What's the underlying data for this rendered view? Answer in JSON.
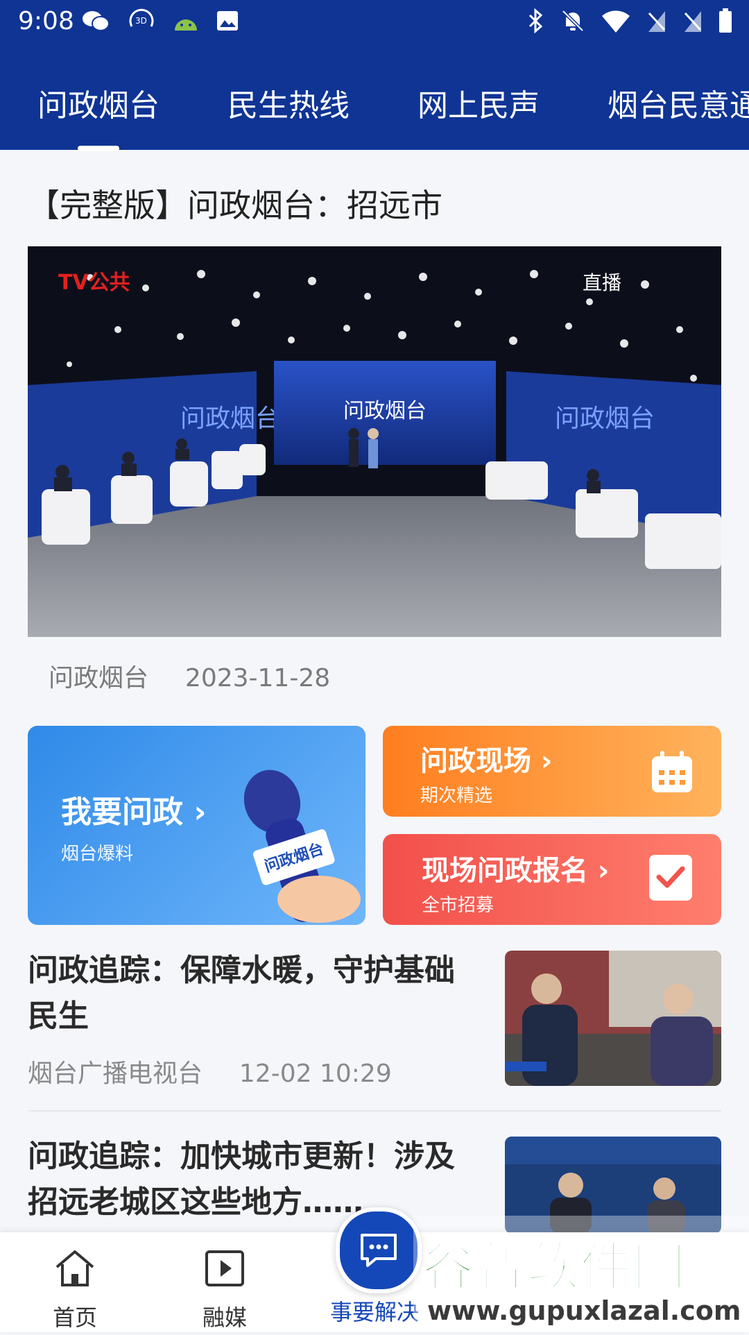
{
  "status_bar": {
    "time": "9:08",
    "left_icons": [
      "wechat-icon",
      "3d-icon",
      "android-icon",
      "image-icon"
    ],
    "right_icons": [
      "bluetooth-icon",
      "bell-off-icon",
      "wifi-icon",
      "no-sim-icon",
      "no-sim-icon",
      "battery-icon"
    ]
  },
  "tabs": [
    {
      "label": "问政烟台",
      "active": true
    },
    {
      "label": "民生热线",
      "active": false
    },
    {
      "label": "网上民声",
      "active": false
    },
    {
      "label": "烟台民意通",
      "active": false
    }
  ],
  "featured": {
    "title": "【完整版】问政烟台：招远市",
    "video": {
      "logo_text": "TV公共",
      "live_label": "直播",
      "screen_text": "问政烟台",
      "wall_text": "问政烟台"
    },
    "source": "问政烟台",
    "date": "2023-11-28"
  },
  "cards": {
    "ask": {
      "title": "我要问政 ›",
      "subtitle": "烟台爆料",
      "mic_text": "问政烟台"
    },
    "scene": {
      "title": "问政现场 ›",
      "subtitle": "期次精选"
    },
    "signup": {
      "title": "现场问政报名 ›",
      "subtitle": "全市招募"
    }
  },
  "news": [
    {
      "title": "问政追踪：保障水暖，守护基础民生",
      "source": "烟台广播电视台",
      "time": "12-02  10:29"
    },
    {
      "title": "问政追踪：加快城市更新！涉及招远老城区这些地方……"
    }
  ],
  "bottom_nav": [
    {
      "label": "首页",
      "icon": "home-icon"
    },
    {
      "label": "融媒",
      "icon": "play-icon"
    },
    {
      "label": "事要解决",
      "icon": "chat-icon"
    }
  ],
  "watermark": {
    "brand": "谷普软件园",
    "url": "www.gupuxlazal.com"
  },
  "colors": {
    "primary": "#0f3494",
    "card_blue": "#3d97ee",
    "card_orange": "#ff8a2a",
    "card_red": "#f45a4f"
  }
}
